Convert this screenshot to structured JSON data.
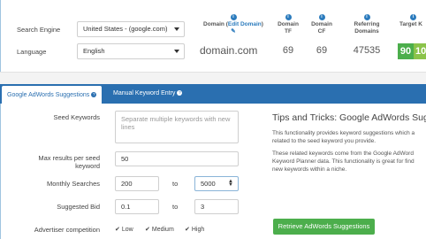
{
  "top": {
    "search_engine_label": "Search Engine",
    "search_engine_value": "United States - (google.com)",
    "language_label": "Language",
    "language_value": "English",
    "domain_header_prefix": "Domain (",
    "domain_header_link": "Edit Domain",
    "domain_header_suffix": ")",
    "domain_tf_header": [
      "Domain",
      "TF"
    ],
    "domain_cf_header": [
      "Domain",
      "CF"
    ],
    "referring_header": [
      "Referring",
      "Domains"
    ],
    "target_header": "Target K",
    "domain_value": "domain.com",
    "domain_tf": "69",
    "domain_cf": "69",
    "referring_domains": "47535",
    "score_1": "90",
    "score_2": "10"
  },
  "tabs": {
    "active": "Google AdWords Suggestions",
    "inactive": "Manual Keyword Entry"
  },
  "form": {
    "seed_keywords_label": "Seed Keywords",
    "seed_keywords_placeholder": "Separate multiple keywords with new lines",
    "max_results_label": [
      "Max results per seed",
      "keyword"
    ],
    "max_results_value": "50",
    "monthly_searches_label": "Monthly Searches",
    "monthly_min": "200",
    "to_label": "to",
    "monthly_max": "5000",
    "suggested_bid_label": "Suggested Bid",
    "bid_min": "0.1",
    "bid_max": "3",
    "advertiser_label": "Advertiser competition",
    "competition": [
      "Low",
      "Medium",
      "High"
    ]
  },
  "tips": {
    "title": "Tips and Tricks: Google AdWords Sugges",
    "p1": [
      "This functionality provides keyword suggestions which a",
      "related to the seed keyword you provide."
    ],
    "p2": [
      "These related keywords come from the Google AdWord",
      "Keyword Planner data. This functionality is great for find",
      "new keywords within a niche."
    ]
  },
  "retrieve_button": "Retrieve AdWords Suggestions",
  "colors": {
    "tab_blue": "#2a6fb0",
    "green": "#4cae4c",
    "green_light": "#8bc34a"
  }
}
